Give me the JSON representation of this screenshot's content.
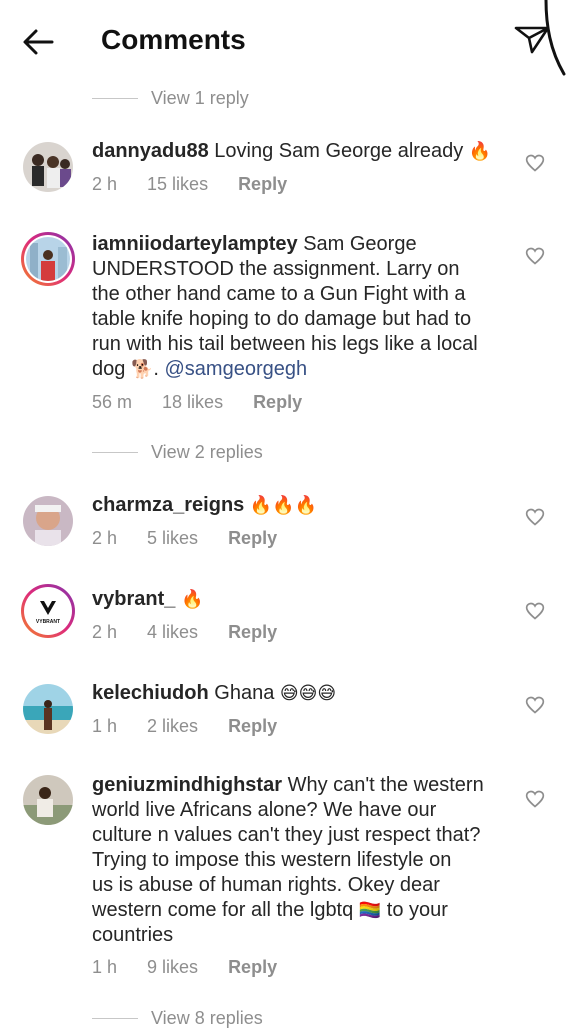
{
  "header": {
    "title": "Comments"
  },
  "threads": [
    {
      "view_label": "View 1 reply"
    },
    {
      "view_label": "View 2 replies"
    },
    {
      "view_label": "View 8 replies"
    }
  ],
  "comments": [
    {
      "username": "dannyadu88",
      "lines": [
        "Loving Sam George already"
      ],
      "emoji": "🔥",
      "time": "2 h",
      "likes": "15 likes",
      "reply": "Reply",
      "avatar_icon": "group-photo-avatar"
    },
    {
      "username": "iamniiodarteylamptey",
      "lines": [
        "Sam George",
        "UNDERSTOOD the assignment. Larry on",
        "the other hand  came to a Gun Fight with a",
        "table knife hoping to do damage but had to",
        "run with his tail between his legs like a local",
        "dog"
      ],
      "emoji": "🐕",
      "after_emoji": ". ",
      "mention": "@samgeorgegh",
      "time": "56 m",
      "likes": "18 likes",
      "reply": "Reply",
      "avatar_icon": "person-in-city-avatar"
    },
    {
      "username": "charmza_reigns",
      "lines": [
        ""
      ],
      "emoji": "🔥🔥🔥",
      "time": "2 h",
      "likes": "5 likes",
      "reply": "Reply",
      "avatar_icon": "selfie-avatar"
    },
    {
      "username": "vybrant_",
      "lines": [
        ""
      ],
      "emoji": "🔥",
      "time": "2 h",
      "likes": "4 likes",
      "reply": "Reply",
      "avatar_icon": "vybrant-logo-avatar",
      "logo_text": "VYBRANT"
    },
    {
      "username": "kelechiudoh",
      "lines": [
        "Ghana"
      ],
      "emoji": "😅😅😅",
      "time": "1 h",
      "likes": "2 likes",
      "reply": "Reply",
      "avatar_icon": "beach-avatar"
    },
    {
      "username": "geniuzmindhighstar",
      "lines": [
        "Why can't the western",
        "world live Africans alone? We have our",
        "culture n values can't they just respect that?",
        "Trying to impose this western lifestyle on",
        "us is abuse of human rights. Okey dear",
        "western come for all the lgbtq"
      ],
      "emoji": "🏳️‍🌈",
      "after_emoji": " to your",
      "tail_line": "countries",
      "time": "1 h",
      "likes": "9 likes",
      "reply": "Reply",
      "avatar_icon": "person-outdoors-avatar"
    }
  ],
  "colors": {
    "text": "#262626",
    "muted": "#8e8e8e",
    "mention": "#385185",
    "story_ring": "#dd2a7b"
  }
}
